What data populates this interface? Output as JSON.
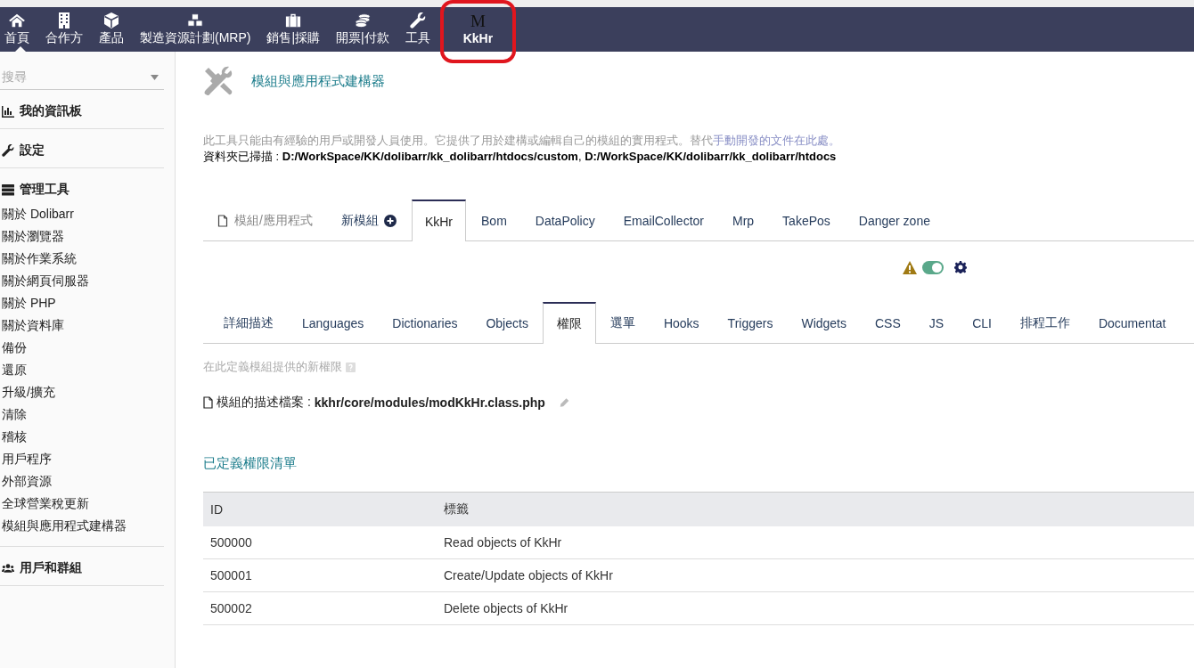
{
  "top_menu": [
    {
      "label": "首頁",
      "selected": true,
      "highlighted": false
    },
    {
      "label": "合作方",
      "selected": false,
      "highlighted": false
    },
    {
      "label": "產品",
      "selected": false,
      "highlighted": false
    },
    {
      "label": "製造資源計劃(MRP)",
      "selected": false,
      "highlighted": false
    },
    {
      "label": "銷售|採購",
      "selected": false,
      "highlighted": false
    },
    {
      "label": "開票|付款",
      "selected": false,
      "highlighted": false
    },
    {
      "label": "工具",
      "selected": false,
      "highlighted": false
    },
    {
      "label": "KkHr",
      "icon_text": "M",
      "selected": false,
      "highlighted": true
    }
  ],
  "sidebar": {
    "search": {
      "placeholder": "搜尋"
    },
    "sections": [
      {
        "title": "我的資訊板"
      },
      {
        "title": "設定"
      },
      {
        "title": "管理工具",
        "items": [
          "關於 Dolibarr",
          "關於瀏覽器",
          "關於作業系統",
          "關於網頁伺服器",
          "關於 PHP",
          "關於資料庫",
          "備份",
          "還原",
          "升級/擴充",
          "清除",
          "稽核",
          "用戶程序",
          "外部資源",
          "全球營業稅更新",
          "模組與應用程式建構器"
        ]
      },
      {
        "title": "用戶和群組"
      }
    ]
  },
  "page": {
    "title": "模組與應用程式建構器",
    "description": "此工具只能由有經驗的用戶或開發人員使用。它提供了用於建構或編輯自己的模組的實用程式。替代",
    "description_link": "手動開發的文件在此處。",
    "scanned_label": "資料夾已掃描 :",
    "scanned_paths": "**D:/WorkSpace/KK/dolibarr/kk_dolibarr/htdocs/custom**, **D:/WorkSpace/KK/dolibarr/kk_dolibarr/htdocs**",
    "module_tabs": [
      {
        "label": "模組/應用程式",
        "kind": "label",
        "selected": false
      },
      {
        "label": "新模組",
        "kind": "new",
        "selected": false
      },
      {
        "label": "KkHr",
        "kind": "module",
        "selected": true
      },
      {
        "label": "Bom",
        "kind": "module",
        "selected": false
      },
      {
        "label": "DataPolicy",
        "kind": "module",
        "selected": false
      },
      {
        "label": "EmailCollector",
        "kind": "module",
        "selected": false
      },
      {
        "label": "Mrp",
        "kind": "module",
        "selected": false
      },
      {
        "label": "TakePos",
        "kind": "module",
        "selected": false
      },
      {
        "label": "Danger zone",
        "kind": "module",
        "selected": false
      }
    ],
    "module_status": {
      "warning": true,
      "enabled": true
    },
    "sub_tabs": [
      {
        "label": "詳細描述",
        "selected": false
      },
      {
        "label": "Languages",
        "selected": false
      },
      {
        "label": "Dictionaries",
        "selected": false
      },
      {
        "label": "Objects",
        "selected": false
      },
      {
        "label": "權限",
        "selected": true
      },
      {
        "label": "選單",
        "selected": false
      },
      {
        "label": "Hooks",
        "selected": false
      },
      {
        "label": "Triggers",
        "selected": false
      },
      {
        "label": "Widgets",
        "selected": false
      },
      {
        "label": "CSS",
        "selected": false
      },
      {
        "label": "JS",
        "selected": false
      },
      {
        "label": "CLI",
        "selected": false
      },
      {
        "label": "排程工作",
        "selected": false
      },
      {
        "label": "Documentat",
        "selected": false
      }
    ],
    "hint": "在此定義模組提供的新權限",
    "file_label": "模組的描述檔案 :",
    "file_path": "kkhr/core/modules/modKkHr.class.php",
    "list_title": "已定義權限清單",
    "table": {
      "columns": [
        "ID",
        "標籤"
      ],
      "rows": [
        [
          "500000",
          "Read objects of KkHr"
        ],
        [
          "500001",
          "Create/Update objects of KkHr"
        ],
        [
          "500002",
          "Delete objects of KkHr"
        ]
      ]
    }
  }
}
